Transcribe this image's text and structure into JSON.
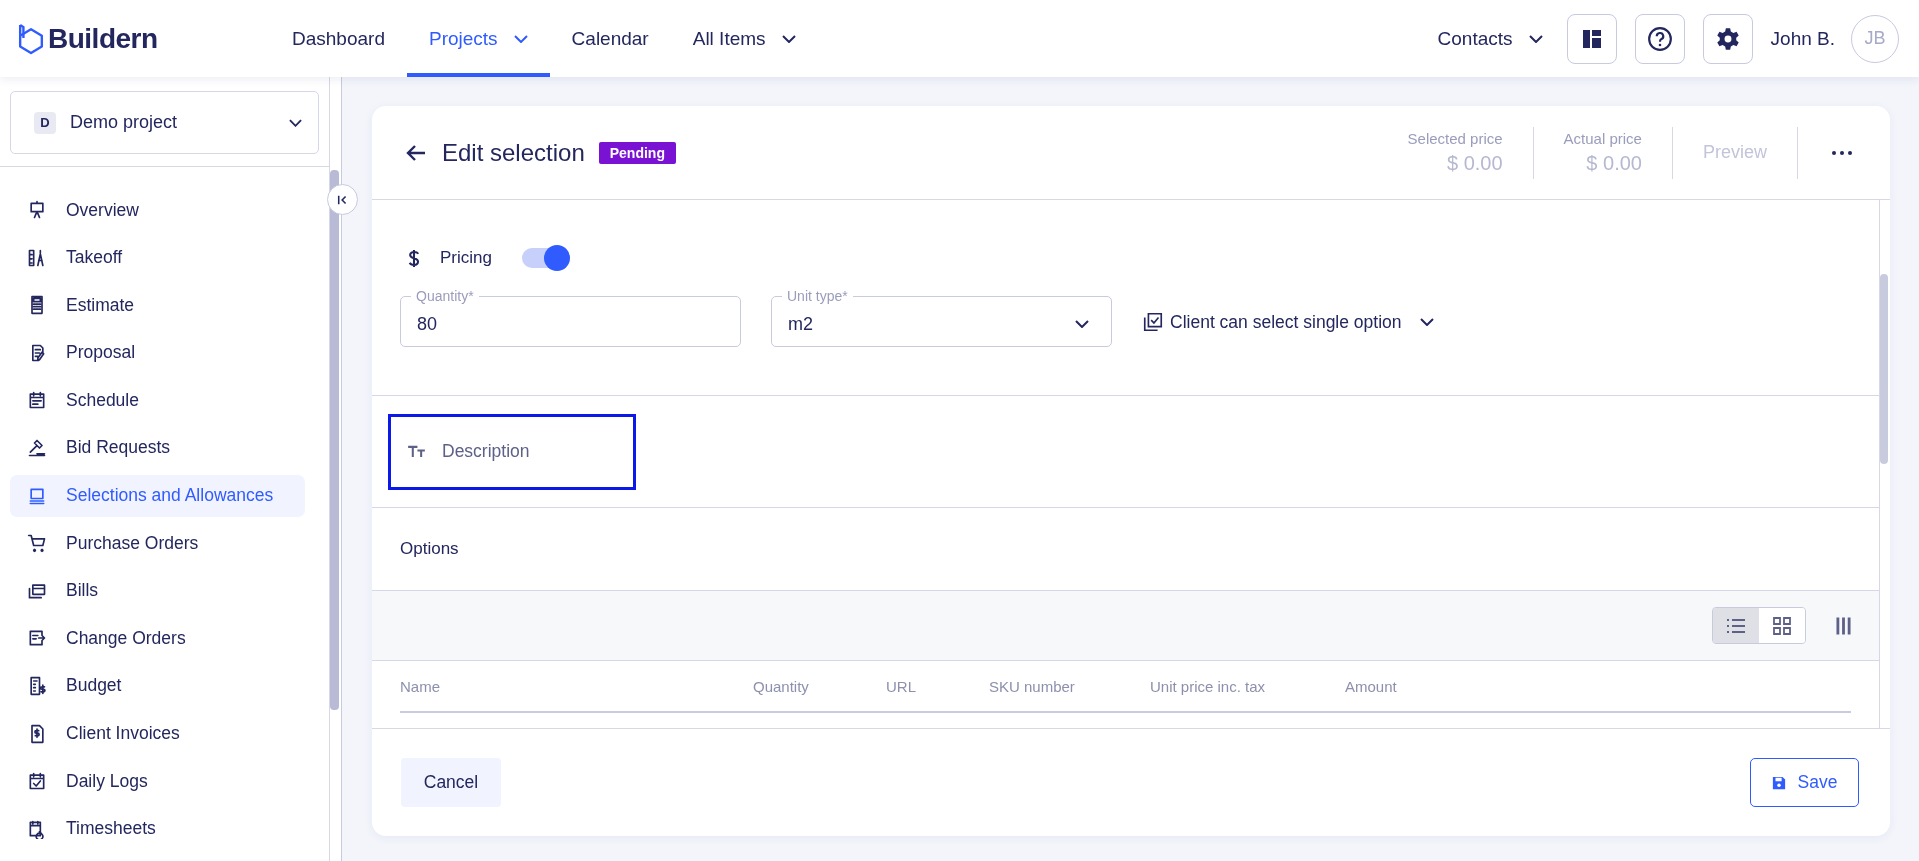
{
  "logo": {
    "text": "Buildern"
  },
  "nav": [
    {
      "label": "Dashboard",
      "selected": false,
      "dropdown": false
    },
    {
      "label": "Projects",
      "selected": true,
      "dropdown": true
    },
    {
      "label": "Calendar",
      "selected": false,
      "dropdown": false
    },
    {
      "label": "All Items",
      "selected": false,
      "dropdown": true
    }
  ],
  "user_bar": {
    "contacts": "Contacts",
    "user_name": "John B.",
    "avatar_initials": "JB"
  },
  "project_selector": {
    "badge": "D",
    "name": "Demo project"
  },
  "sidebar": {
    "items": [
      {
        "label": "Overview",
        "selected": false
      },
      {
        "label": "Takeoff",
        "selected": false
      },
      {
        "label": "Estimate",
        "selected": false
      },
      {
        "label": "Proposal",
        "selected": false
      },
      {
        "label": "Schedule",
        "selected": false
      },
      {
        "label": "Bid Requests",
        "selected": false
      },
      {
        "label": "Selections and Allowances",
        "selected": true
      },
      {
        "label": "Purchase Orders",
        "selected": false
      },
      {
        "label": "Bills",
        "selected": false
      },
      {
        "label": "Change Orders",
        "selected": false
      },
      {
        "label": "Budget",
        "selected": false
      },
      {
        "label": "Client Invoices",
        "selected": false
      },
      {
        "label": "Daily Logs",
        "selected": false
      },
      {
        "label": "Timesheets",
        "selected": false
      }
    ]
  },
  "header": {
    "title": "Edit selection",
    "status": "Pending",
    "prices": [
      {
        "label": "Selected price",
        "value": "$ 0.00"
      },
      {
        "label": "Actual price",
        "value": "$ 0.00"
      }
    ],
    "preview": {
      "label": "Preview",
      "disabled": true
    }
  },
  "pricing": {
    "label": "Pricing",
    "on": true,
    "quantity": {
      "label": "Quantity*",
      "value": "80"
    },
    "unit_type": {
      "label": "Unit type*",
      "value": "m2"
    },
    "selection_mode": "Client can select single option"
  },
  "description": {
    "label": "Description"
  },
  "options": {
    "title": "Options",
    "views": [
      {
        "kind": "list",
        "selected": true
      },
      {
        "kind": "grid",
        "selected": false
      }
    ],
    "columns": [
      "Name",
      "Quantity",
      "URL",
      "SKU number",
      "Unit price inc. tax",
      "Amount"
    ]
  },
  "footer": {
    "cancel": "Cancel",
    "save": "Save"
  }
}
